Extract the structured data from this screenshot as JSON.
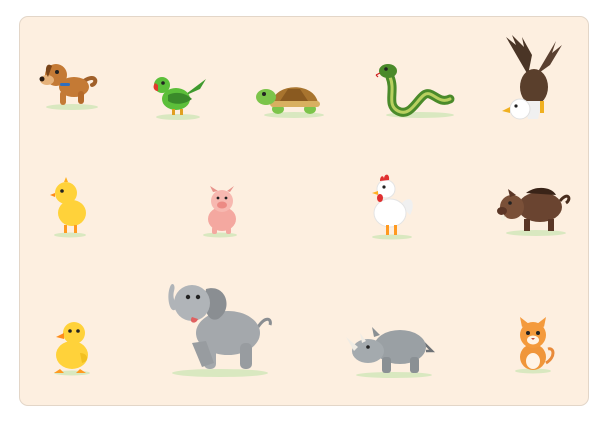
{
  "board": {
    "background": "#fdefe0",
    "border_color": "#e3d6c8"
  },
  "animals": [
    {
      "name": "dog"
    },
    {
      "name": "parrot"
    },
    {
      "name": "turtle"
    },
    {
      "name": "snake"
    },
    {
      "name": "eagle"
    },
    {
      "name": "chick"
    },
    {
      "name": "pig"
    },
    {
      "name": "rooster"
    },
    {
      "name": "boar"
    },
    {
      "name": "duckling"
    },
    {
      "name": "elephant"
    },
    {
      "name": "rhino"
    },
    {
      "name": "kitten"
    }
  ]
}
